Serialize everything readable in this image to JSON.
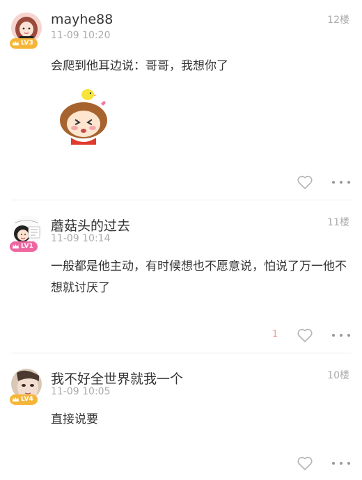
{
  "posts": [
    {
      "username": "mayhe88",
      "time": "11-09 10:20",
      "floor": "12楼",
      "level": "LV3",
      "content": "会爬到他耳边说：哥哥，我想你了",
      "sticker": "girl-blush-sticker",
      "like_count": ""
    },
    {
      "username": "蘑菇头的过去",
      "time": "11-09 10:14",
      "floor": "11楼",
      "level": "LV1",
      "content": "一般都是他主动，有时候想也不愿意说，怕说了万一他不想就讨厌了",
      "like_count": "1"
    },
    {
      "username": "我不好全世界就我一个",
      "time": "11-09 10:05",
      "floor": "10楼",
      "level": "LV4",
      "content": "直接说要",
      "like_count": ""
    }
  ],
  "colors": {
    "level_badge": "#f5b638",
    "level_badge_lv1": "#ee66a0",
    "like_count": "#f19a9a",
    "text_secondary": "#aaaaaa"
  },
  "icons": {
    "like": "heart-outline-icon",
    "more": "more-dots-icon",
    "level": "crown-icon"
  }
}
